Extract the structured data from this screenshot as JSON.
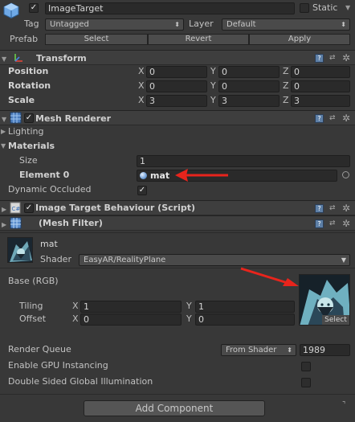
{
  "object": {
    "name": "ImageTarget",
    "static_label": "Static",
    "tag_label": "Tag",
    "tag_value": "Untagged",
    "layer_label": "Layer",
    "layer_value": "Default",
    "prefab_label": "Prefab",
    "prefab_buttons": [
      "Select",
      "Revert",
      "Apply"
    ]
  },
  "transform": {
    "title": "Transform",
    "rows": [
      {
        "label": "Position",
        "x": "0",
        "y": "0",
        "z": "0"
      },
      {
        "label": "Rotation",
        "x": "0",
        "y": "0",
        "z": "0"
      },
      {
        "label": "Scale",
        "x": "3",
        "y": "3",
        "z": "3"
      }
    ],
    "axes": [
      "X",
      "Y",
      "Z"
    ]
  },
  "mesh_renderer": {
    "title": "Mesh Renderer",
    "lighting": "Lighting",
    "materials": "Materials",
    "size_label": "Size",
    "size_value": "1",
    "element_label": "Element 0",
    "element_value": "mat",
    "dynamic_occluded": "Dynamic Occluded"
  },
  "image_target": {
    "title": "Image Target Behaviour (Script)"
  },
  "mesh_filter": {
    "title": "(Mesh Filter)"
  },
  "material": {
    "name": "mat",
    "shader_label": "Shader",
    "shader_value": "EasyAR/RealityPlane",
    "base_label": "Base (RGB)",
    "tiling_label": "Tiling",
    "tiling_x": "1",
    "tiling_y": "1",
    "offset_label": "Offset",
    "offset_x": "0",
    "offset_y": "0",
    "tex_select": "Select",
    "render_queue_label": "Render Queue",
    "render_queue_mode": "From Shader",
    "render_queue_value": "1989",
    "gpu_instancing": "Enable GPU Instancing",
    "double_sided_gi": "Double Sided Global Illumination"
  },
  "add_component": "Add Component",
  "colors": {
    "background": "#383838",
    "header": "#3e3e3e",
    "field": "#2a2a2a",
    "arrow_red": "#e8241c"
  }
}
